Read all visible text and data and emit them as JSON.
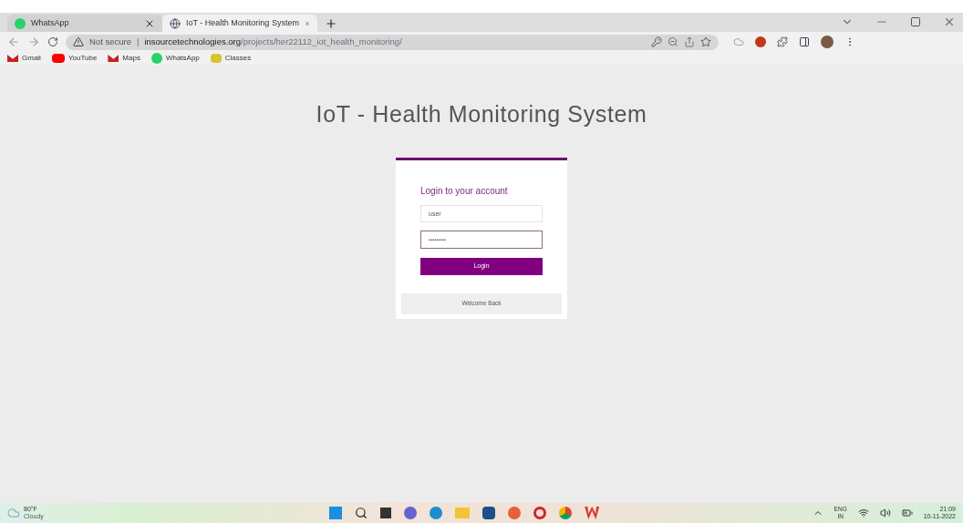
{
  "browser": {
    "tabs": [
      {
        "title": "WhatsApp",
        "selected": false,
        "kind": "whatsapp"
      },
      {
        "title": "IoT - Health Monitoring System",
        "selected": true,
        "kind": "globe"
      }
    ],
    "address": {
      "security": "Not secure",
      "separator": "|",
      "host": "insourcetechnologies.org",
      "path": "/projects/her22112_iot_health_monitoring/"
    },
    "bookmarks": [
      {
        "label": "Gmail",
        "kind": "gmail"
      },
      {
        "label": "YouTube",
        "kind": "youtube"
      },
      {
        "label": "Maps",
        "kind": "gmail"
      },
      {
        "label": "WhatsApp",
        "kind": "whatsapp"
      },
      {
        "label": "Classes",
        "kind": "classes"
      }
    ]
  },
  "page": {
    "heading": "IoT - Health Monitoring System",
    "login": {
      "title": "Login to your account",
      "username": "user",
      "password": "•••••••••",
      "button": "Login",
      "footer": "Welcome Back"
    }
  },
  "taskbar": {
    "weather": {
      "temp": "80°F",
      "condition": "Cloudy"
    },
    "language": "ENG",
    "region": "IN",
    "time": "21:09",
    "date": "10-11-2022"
  }
}
